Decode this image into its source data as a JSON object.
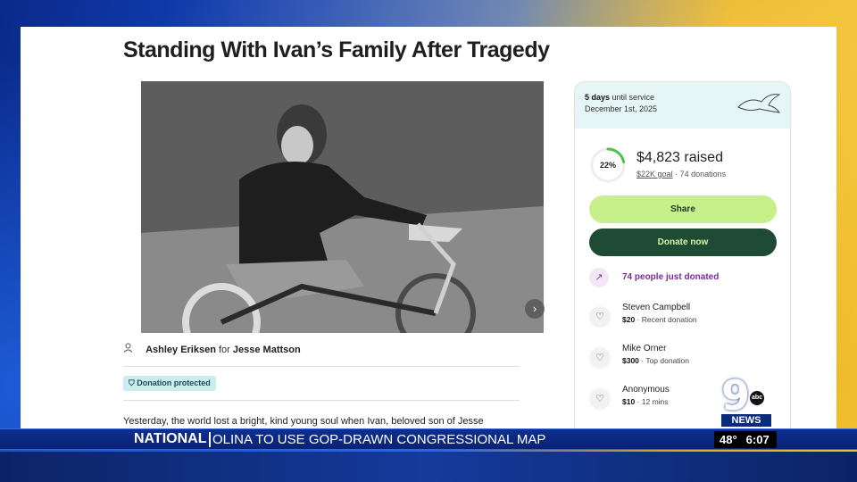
{
  "page": {
    "title": "Standing With Ivan’s Family After Tragedy",
    "organizer": {
      "name": "Ashley Eriksen",
      "connector": "for",
      "beneficiary": "Jesse Mattson"
    },
    "protected_badge": "Donation protected",
    "story_excerpt": "Yesterday, the world lost a bright, kind young soul when Ivan, beloved son of Jesse",
    "photo_arrow": "›"
  },
  "donation_card": {
    "service_days": "5 days",
    "service_suffix": "until service",
    "service_date": "December 1st, 2025",
    "progress_label": "22%",
    "progress_fraction": 0.22,
    "raised": "$4,823 raised",
    "goal": "$22K goal",
    "donation_count": "74 donations",
    "share_label": "Share",
    "donate_label": "Donate now",
    "trend_text": "74 people just donated",
    "donors": [
      {
        "name": "Steven Campbell",
        "amount": "$20",
        "detail": "Recent donation"
      },
      {
        "name": "Mike Orner",
        "amount": "$300",
        "detail": "Top donation"
      },
      {
        "name": "Anonymous",
        "amount": "$10",
        "detail": "12 mins"
      }
    ]
  },
  "broadcast": {
    "station": "KEZI",
    "channel": "9",
    "network": "abc",
    "news": "NEWS",
    "ticker_label": "NATIONAL",
    "ticker_headline": "OLINA TO USE GOP-DRAWN CONGRESSIONAL MAP",
    "temperature": "48°",
    "time": "6:07"
  },
  "colors": {
    "share_button": "#c8f08a",
    "donate_button": "#1f4a33",
    "card_header": "#e6f6f6",
    "progress_green": "#4ec24a",
    "trend_purple": "#7b2d96",
    "ticker_blue": "#0d2f8f"
  }
}
